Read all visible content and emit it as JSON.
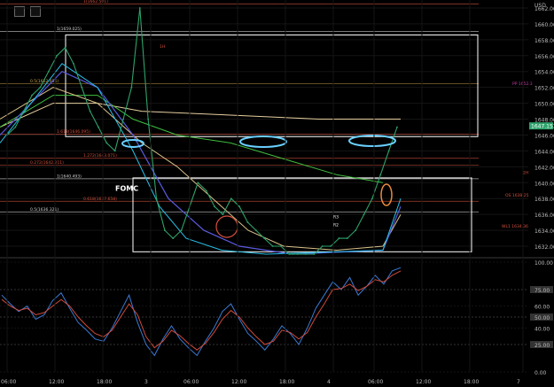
{
  "toolbar": {
    "buttons": [
      "expand-icon",
      "close-icon"
    ]
  },
  "chart_data": [
    {
      "type": "line",
      "panel": "price",
      "currency_label": "USD",
      "y_ticks": [
        "1662.000",
        "1660.000",
        "1658.000",
        "1656.000",
        "1654.000",
        "1652.000",
        "1650.000",
        "1648.000",
        "1646.000",
        "1644.000",
        "1642.000",
        "1640.000",
        "1638.000",
        "1636.000",
        "1634.000",
        "1632.000"
      ],
      "ylim": [
        1631,
        1663
      ],
      "current_price_label": "1647.153",
      "current_price": 1647.15,
      "x_ticks": [
        "06:00",
        "12:00",
        "18:00",
        "3",
        "06:00",
        "12:00",
        "18:00",
        "4",
        "06:00",
        "12:00",
        "18:00",
        "7"
      ],
      "fib_labels": [
        {
          "text": "0.5(1652.456)",
          "value": 1652.456
        },
        {
          "text": "1.618(1646.095)",
          "value": 1646.095
        },
        {
          "text": "1.272(1643.071)",
          "value": 1643.071
        },
        {
          "text": "0.272(1642.211)",
          "value": 1642.211
        },
        {
          "text": "1(1640.493)",
          "value": 1640.493
        },
        {
          "text": "0.618(1637.658)",
          "value": 1637.658
        },
        {
          "text": "0.5(1636.321)",
          "value": 1636.321
        },
        {
          "text": "1(1659.025)",
          "value": 1659.025
        },
        {
          "text": "1(1662.501)",
          "value": 1662.501
        }
      ],
      "annotations": [
        "FOMC",
        "1H",
        "PP 1652.3",
        "2H",
        "OS 1638.25",
        "WL1 1634.36",
        "R3",
        "R2"
      ],
      "series": [
        {
          "name": "price",
          "color": "#2ea36b",
          "values": [
            1646,
            1647,
            1649,
            1651,
            1652,
            1654,
            1656,
            1657,
            1655,
            1652,
            1649,
            1647,
            1645,
            1644,
            1648,
            1652,
            1662,
            1648,
            1638,
            1634,
            1633,
            1634,
            1637,
            1640,
            1639,
            1637,
            1636,
            1638,
            1637,
            1635,
            1634,
            1633,
            1632,
            1632,
            1631,
            1631,
            1631,
            1631,
            1632,
            1632,
            1633,
            1633,
            1634,
            1636,
            1638,
            1641,
            1644,
            1647
          ]
        }
      ]
    },
    {
      "type": "line",
      "panel": "oscillator",
      "y_ticks": [
        "100.00",
        "75.00",
        "60.00",
        "50.00",
        "40.00",
        "25.00",
        "0.00"
      ],
      "ylim": [
        0,
        100
      ],
      "series": [
        {
          "name": "fast",
          "color": "#3a7bd5",
          "values": [
            70,
            62,
            55,
            60,
            48,
            52,
            65,
            72,
            58,
            45,
            38,
            30,
            28,
            40,
            55,
            70,
            45,
            25,
            15,
            30,
            42,
            30,
            22,
            15,
            28,
            40,
            55,
            62,
            48,
            35,
            28,
            20,
            30,
            42,
            35,
            25,
            40,
            58,
            70,
            82,
            75,
            86,
            70,
            78,
            88,
            80,
            92,
            95
          ]
        },
        {
          "name": "slow",
          "color": "#d04a3a",
          "values": [
            66,
            60,
            56,
            58,
            52,
            54,
            60,
            66,
            60,
            50,
            42,
            35,
            32,
            38,
            50,
            62,
            52,
            32,
            22,
            28,
            38,
            33,
            26,
            20,
            26,
            36,
            48,
            56,
            50,
            40,
            32,
            25,
            28,
            38,
            36,
            30,
            36,
            50,
            62,
            75,
            76,
            80,
            74,
            78,
            84,
            82,
            88,
            92
          ]
        }
      ]
    }
  ]
}
